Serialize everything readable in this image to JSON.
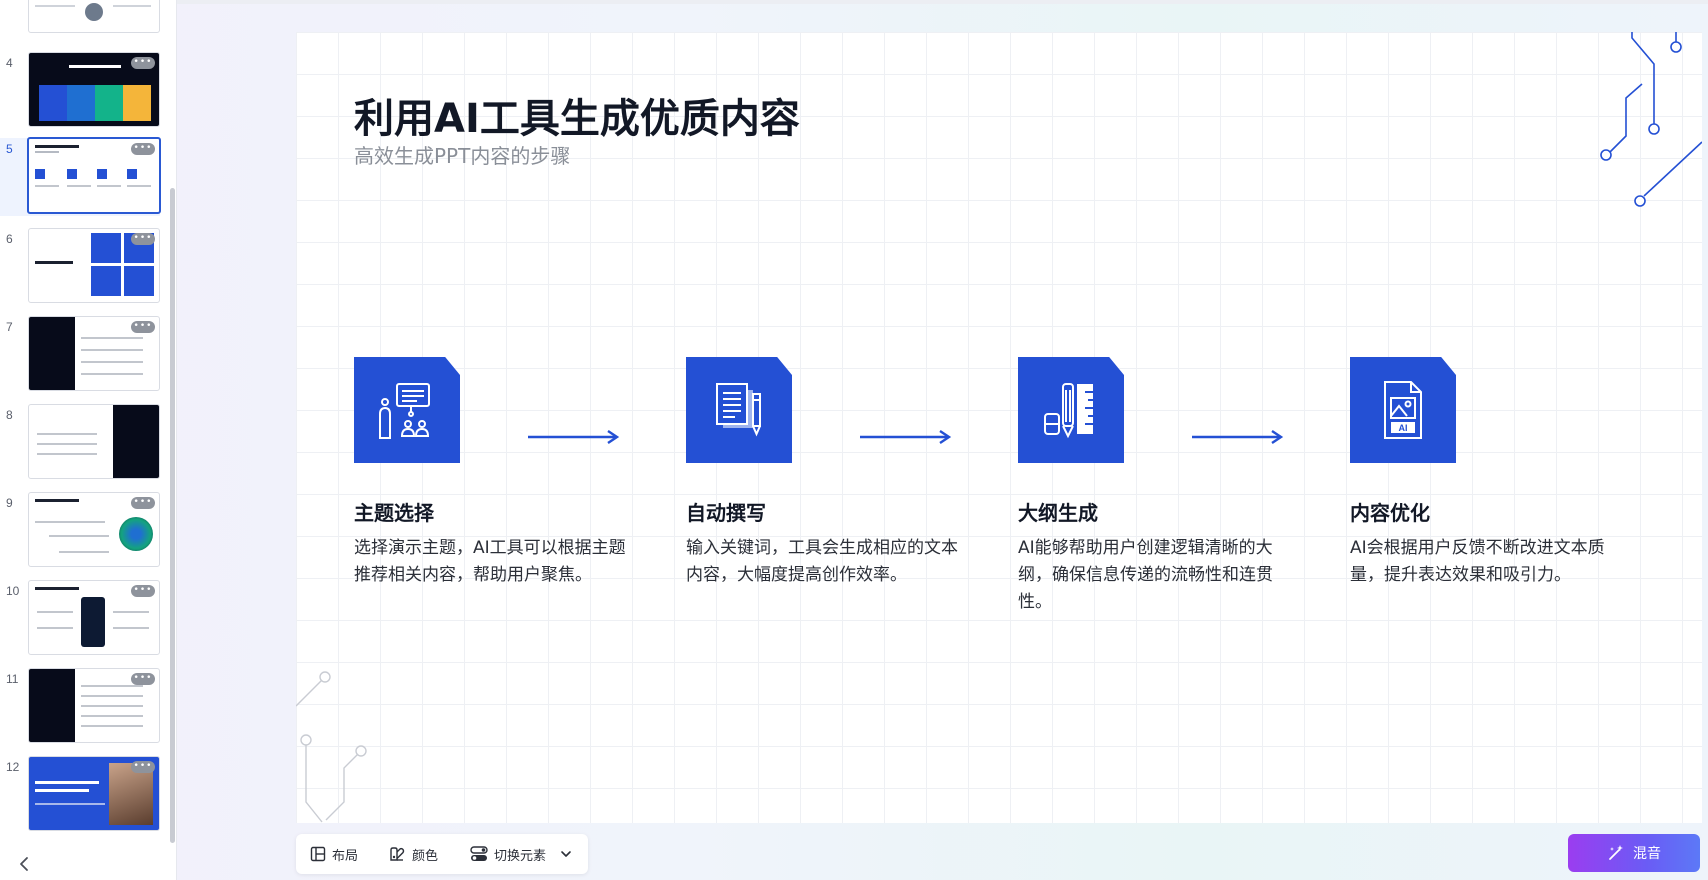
{
  "sidebar": {
    "slides": [
      {
        "num": "4"
      },
      {
        "num": "5"
      },
      {
        "num": "6"
      },
      {
        "num": "7"
      },
      {
        "num": "8"
      },
      {
        "num": "9"
      },
      {
        "num": "10"
      },
      {
        "num": "11"
      },
      {
        "num": "12"
      }
    ],
    "active_slide": "5",
    "more_label": "•••"
  },
  "slide": {
    "title": "利用AI工具生成优质内容",
    "subtitle": "高效生成PPT内容的步骤",
    "steps": [
      {
        "title": "主题选择",
        "desc": "选择演示主题，AI工具可以根据主题推荐相关内容，帮助用户聚焦。",
        "icon": "presentation-audience-icon"
      },
      {
        "title": "自动撰写",
        "desc": "输入关键词，工具会生成相应的文本内容，大幅度提高创作效率。",
        "icon": "document-pen-icon"
      },
      {
        "title": "大纲生成",
        "desc": "AI能够帮助用户创建逻辑清晰的大纲，确保信息传递的流畅性和连贯性。",
        "icon": "pencil-ruler-icon"
      },
      {
        "title": "内容优化",
        "desc": "AI会根据用户反馈不断改进文本质量，提升表达效果和吸引力。",
        "icon": "ai-image-file-icon"
      }
    ]
  },
  "toolbar": {
    "layout_label": "布局",
    "color_label": "颜色",
    "switch_label": "切换元素"
  },
  "mix_button_label": "混音",
  "colors": {
    "accent": "#2450d4",
    "mix_gradient_start": "#9b3df0",
    "mix_gradient_end": "#5c79f7"
  }
}
